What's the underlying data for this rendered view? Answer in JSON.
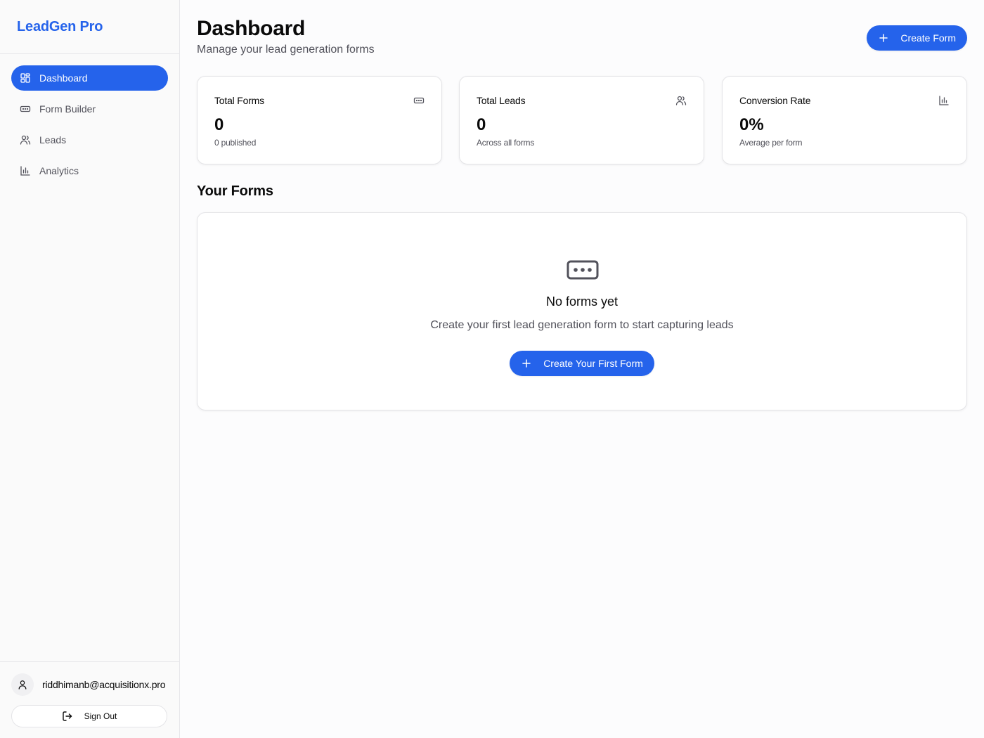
{
  "sidebar": {
    "brand": "LeadGen Pro",
    "items": [
      {
        "label": "Dashboard",
        "icon": "layout-dashboard-icon",
        "active": true
      },
      {
        "label": "Form Builder",
        "icon": "form-input-icon",
        "active": false
      },
      {
        "label": "Leads",
        "icon": "users-icon",
        "active": false
      },
      {
        "label": "Analytics",
        "icon": "bar-chart-icon",
        "active": false
      }
    ],
    "user_email": "riddhimanb@acquisitionx.pro",
    "sign_out_label": "Sign Out"
  },
  "header": {
    "title": "Dashboard",
    "subtitle": "Manage your lead generation forms",
    "create_button_label": "Create Form"
  },
  "stats": [
    {
      "label": "Total Forms",
      "value": "0",
      "sub": "0 published",
      "icon": "form-input-icon"
    },
    {
      "label": "Total Leads",
      "value": "0",
      "sub": "Across all forms",
      "icon": "users-icon"
    },
    {
      "label": "Conversion Rate",
      "value": "0%",
      "sub": "Average per form",
      "icon": "bar-chart-icon"
    }
  ],
  "forms_section": {
    "title": "Your Forms",
    "empty_title": "No forms yet",
    "empty_text": "Create your first lead generation form to start capturing leads",
    "empty_button_label": "Create Your First Form"
  },
  "colors": {
    "accent": "#2563eb",
    "sidebar_bg": "#fafafa",
    "muted_text": "#52525b",
    "border": "#e4e4e7"
  }
}
